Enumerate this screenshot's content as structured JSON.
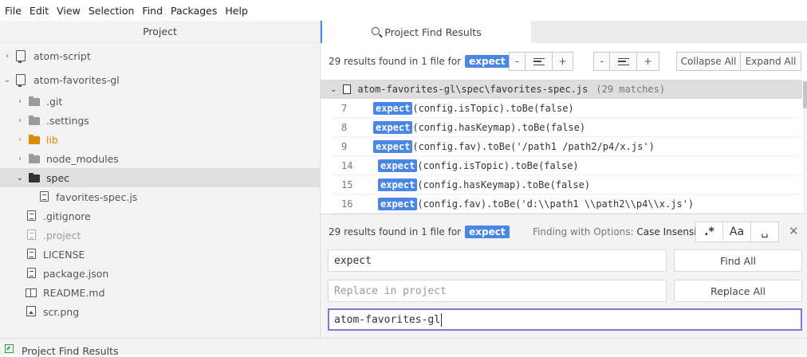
{
  "menu": [
    "File",
    "Edit",
    "View",
    "Selection",
    "Find",
    "Packages",
    "Help"
  ],
  "tree": {
    "header": "Project",
    "items": [
      {
        "label": "atom-script",
        "chev": "›",
        "icon": "repo-icon"
      },
      {
        "label": "atom-favorites-gl",
        "chev": "⌄",
        "icon": "repo-icon"
      },
      {
        "label": ".git",
        "chev": "›",
        "icon": "folder-icon"
      },
      {
        "label": ".settings",
        "chev": "›",
        "icon": "folder-icon"
      },
      {
        "label": "lib",
        "chev": "›",
        "icon": "folder-icon"
      },
      {
        "label": "node_modules",
        "chev": "›",
        "icon": "folder-icon"
      },
      {
        "label": "spec",
        "chev": "⌄",
        "icon": "folder-icon"
      },
      {
        "label": "favorites-spec.js",
        "icon": "file-icon"
      },
      {
        "label": ".gitignore",
        "icon": "file-icon"
      },
      {
        "label": ".project",
        "icon": "file-icon"
      },
      {
        "label": "LICENSE",
        "icon": "file-icon"
      },
      {
        "label": "package.json",
        "icon": "file-icon"
      },
      {
        "label": "README.md",
        "icon": "book-icon"
      },
      {
        "label": "scr.png",
        "icon": "image-icon"
      }
    ]
  },
  "results": {
    "tab_label": "Project Find Results",
    "summary_prefix": "29 results found in 1 file for",
    "query": "expect",
    "group1": {
      "minus": "-",
      "plus": "+"
    },
    "group2": {
      "minus": "-",
      "plus": "+"
    },
    "collapse_all": "Collapse All",
    "expand_all": "Expand All",
    "file_path": "atom-favorites-gl\\spec\\favorites-spec.js",
    "file_matches": "(29 matches)",
    "rows": [
      {
        "line": "7",
        "match": "expect",
        "rest": "(config.isTopic).toBe(false)"
      },
      {
        "line": "8",
        "match": "expect",
        "rest": "(config.hasKeymap).toBe(false)"
      },
      {
        "line": "9",
        "match": "expect",
        "rest": "(config.fav).toBe('/path1 /path2/p4/x.js')"
      },
      {
        "line": "14",
        "match": "expect",
        "rest": "(config.isTopic).toBe(false)"
      },
      {
        "line": "15",
        "match": "expect",
        "rest": "(config.hasKeymap).toBe(false)"
      },
      {
        "line": "16",
        "match": "expect",
        "rest": "(config.fav).toBe('d:\\\\path1 \\\\path2\\\\p4\\\\x.js')"
      }
    ]
  },
  "find": {
    "summary_prefix": "29 results found in 1 file for",
    "query_badge": "expect",
    "options_label": "Finding with Options:",
    "options_value": "Case Insensitive",
    "regex_btn": ".*",
    "case_btn": "Aa",
    "word_btn": "␣",
    "close": "✕",
    "find_value": "expect",
    "find_all": "Find All",
    "replace_placeholder": "Replace in project",
    "replace_all": "Replace All",
    "paths_value": "atom-favorites-gl"
  },
  "status": {
    "label": "Project Find Results"
  }
}
